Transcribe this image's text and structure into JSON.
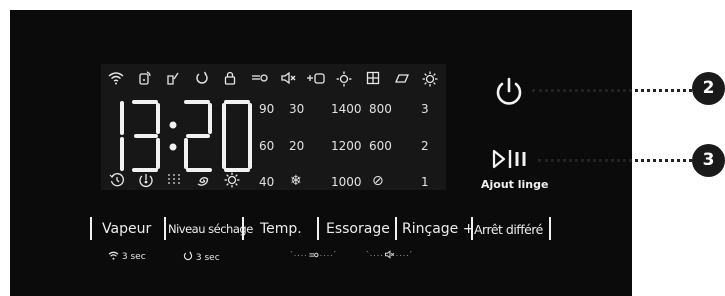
{
  "display": {
    "time": "13:20",
    "icons_top": [
      "wifi-icon",
      "remote-icon",
      "steam-icon",
      "power-icon",
      "lock-icon",
      "key-icon",
      "mute-icon",
      "plus-drop-icon",
      "sun-icon",
      "grid-icon",
      "drying-icon",
      "gear-icon"
    ],
    "icons_bottom": [
      "delay-start-icon",
      "timer-icon",
      "dots-icon",
      "spiral-icon",
      "gear-icon"
    ],
    "temp_col1": [
      "90",
      "60",
      "40"
    ],
    "temp_col2": [
      "30",
      "20",
      "❄"
    ],
    "spin_col1": [
      "1400",
      "1200",
      "1000"
    ],
    "spin_col2": [
      "800",
      "600",
      "⊘"
    ],
    "rinse": [
      "3",
      "2",
      "1"
    ]
  },
  "buttons": {
    "vapeur": "Vapeur",
    "niveau": "Niveau séchage",
    "temp": "Temp.",
    "essorage": "Essorage",
    "rincage": "Rinçage +",
    "arret": "Arrêt différé"
  },
  "hints": {
    "wifi_hold": "3 sec",
    "power_hold": "3 sec"
  },
  "controls": {
    "ajout_linge": "Ajout linge"
  },
  "callouts": [
    "2",
    "3"
  ]
}
